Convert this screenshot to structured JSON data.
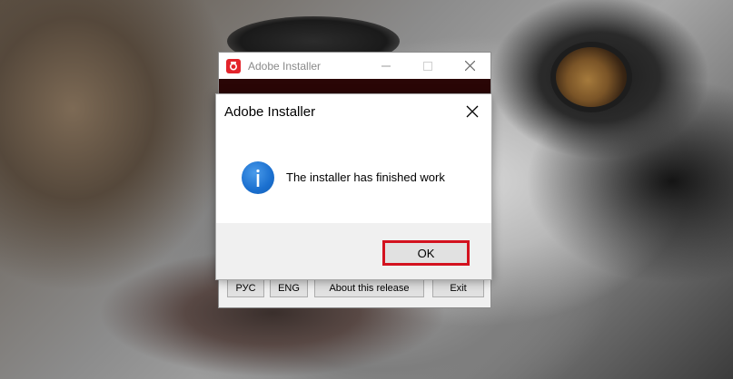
{
  "main_window": {
    "title": "Adobe Installer",
    "buttons": {
      "rus": "РУС",
      "eng": "ENG",
      "about": "About this release",
      "exit": "Exit"
    }
  },
  "dialog": {
    "title": "Adobe Installer",
    "message": "The installer has finished work",
    "ok_label": "OK"
  },
  "icons": {
    "app": "adobe-app-icon",
    "info": "info-icon",
    "close": "close-icon",
    "minimize": "minimize-icon",
    "maximize": "maximize-icon"
  },
  "colors": {
    "accent_red": "#d3121f",
    "info_blue": "#1a6fcf",
    "dark_band": "#2a0606"
  }
}
